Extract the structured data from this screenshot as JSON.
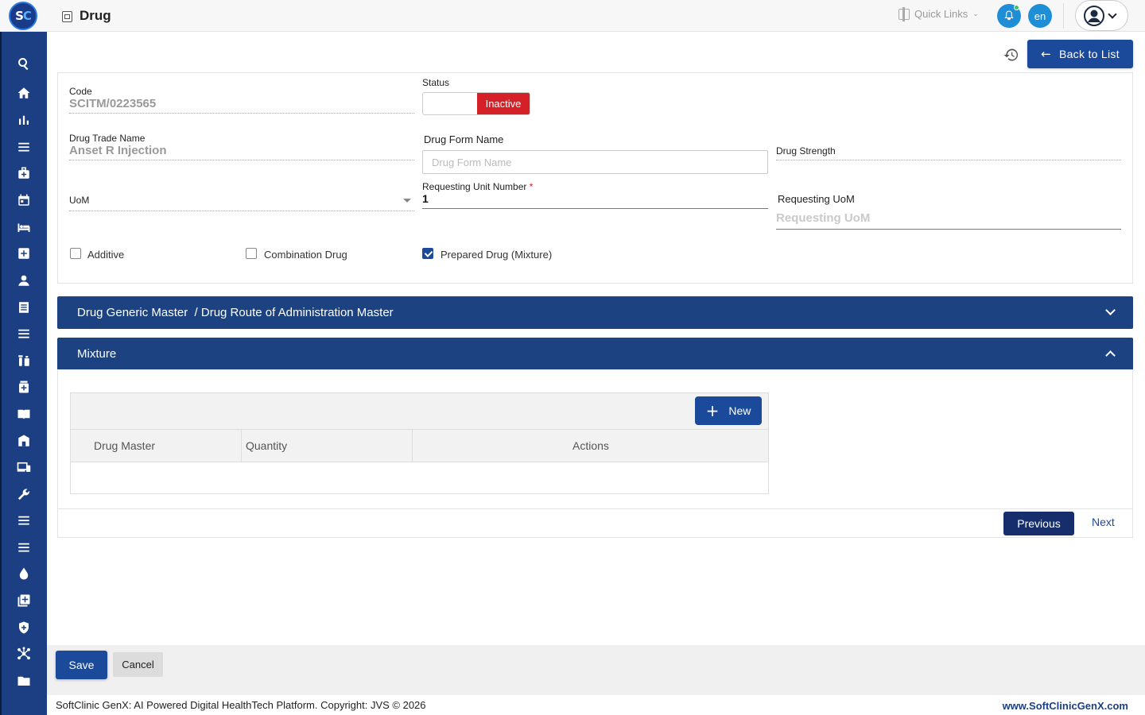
{
  "header": {
    "logo_text_s": "S",
    "logo_text_c": "C",
    "title": "Drug",
    "quick_links": "Quick Links",
    "lang": "en"
  },
  "sidebar": {
    "icons": [
      "search-icon",
      "home-icon",
      "bar-chart-icon",
      "menu-icon",
      "medical-bag-icon",
      "calendar-icon",
      "bed-icon",
      "plus-box-icon",
      "user-icon",
      "receipt-icon",
      "list-icon",
      "lab-icon",
      "pharmacy-icon",
      "book-icon",
      "building-icon",
      "devices-icon",
      "wrench-icon",
      "menu-icon-2",
      "menu-icon-3",
      "drop-icon",
      "add-box-icon",
      "shield-icon",
      "hub-icon",
      "folder-icon"
    ]
  },
  "toolbar": {
    "back_label": "Back to List"
  },
  "form": {
    "code_label": "Code",
    "code_value": "SCITM/0223565",
    "status_label": "Status",
    "status_value": "Inactive",
    "trade_name_label": "Drug Trade Name",
    "trade_name_value": "Anset R Injection",
    "form_name_label": "Drug Form Name",
    "form_name_placeholder": "Drug Form Name",
    "strength_label": "Drug Strength",
    "uom_label": "UoM",
    "req_unit_label": "Requesting Unit Number",
    "req_unit_star": "*",
    "req_unit_value": "1",
    "req_uom_label": "Requesting UoM",
    "req_uom_placeholder": "Requesting UoM",
    "additive_label": "Additive",
    "additive_checked": false,
    "combination_label": "Combination Drug",
    "combination_checked": false,
    "prepared_label": "Prepared Drug (Mixture)",
    "prepared_checked": true
  },
  "accordions": {
    "generic_title": "Drug Generic Master  / Drug Route of Administration Master",
    "mixture_title": "Mixture"
  },
  "mixture_grid": {
    "new_label": "New",
    "columns": [
      "Drug Master",
      "Quantity",
      "Actions"
    ]
  },
  "pager": {
    "previous": "Previous",
    "next": "Next"
  },
  "actions": {
    "save": "Save",
    "cancel": "Cancel"
  },
  "footer": {
    "copyright": "SoftClinic GenX: AI Powered Digital HealthTech Platform. Copyright: JVS © 2026",
    "site": "www.SoftClinicGenX.com"
  },
  "colors": {
    "primary": "#1c4a9a",
    "sidebar": "#1c3f84",
    "inactive": "#d62027",
    "accent_blue": "#1e8fd6"
  }
}
